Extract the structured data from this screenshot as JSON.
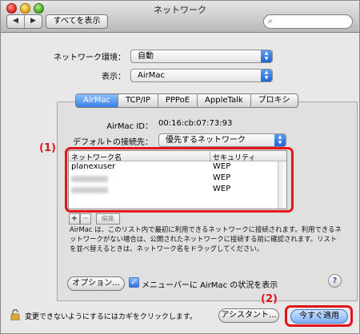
{
  "window": {
    "title": "ネットワーク"
  },
  "toolbar": {
    "back_glyph": "◀",
    "forward_glyph": "▶",
    "show_all": "すべてを表示",
    "search_placeholder": ""
  },
  "location": {
    "label": "ネットワーク環境：",
    "value": "自動"
  },
  "show": {
    "label": "表示：",
    "value": "AirMac"
  },
  "tabs": [
    {
      "label": "AirMac",
      "active": true
    },
    {
      "label": "TCP/IP",
      "active": false
    },
    {
      "label": "PPPoE",
      "active": false
    },
    {
      "label": "AppleTalk",
      "active": false
    },
    {
      "label": "プロキシ",
      "active": false
    }
  ],
  "airmac_id": {
    "label": "AirMac ID：",
    "value": "00:16:cb:07:73:93"
  },
  "default_connect": {
    "label": "デフォルトの接続先：",
    "value": "優先するネットワーク"
  },
  "network_list": {
    "columns": [
      "ネットワーク名",
      "セキュリティ"
    ],
    "rows": [
      {
        "name": "planexuser",
        "security": "WEP",
        "blurred": false
      },
      {
        "name": "",
        "security": "WEP",
        "blurred": true
      },
      {
        "name": "",
        "security": "WEP",
        "blurred": true
      }
    ]
  },
  "list_buttons": {
    "add": "+",
    "remove": "−",
    "edit": "編集"
  },
  "description": "AirMac は、このリスト内で最初に利用できるネットワークに接続されます。利用できるネットワークがない場合は、公開されたネットワークに接続する前に確認されます。リストを並べ替えるときは、ネットワーク名をドラッグしてください。",
  "options_button": "オプション...",
  "menubar_checkbox": {
    "label": "メニューバーに AirMac の状況を表示",
    "checked": true
  },
  "help_glyph": "?",
  "lock_text": "変更できないようにするにはカギをクリックします。",
  "assistant_button": "アシスタント...",
  "apply_button": "今すぐ適用",
  "annotations": {
    "one": "(1)",
    "two": "(2)"
  },
  "colors": {
    "annotation_red": "#e0161b",
    "selection_blue": "#3a7fe5"
  }
}
